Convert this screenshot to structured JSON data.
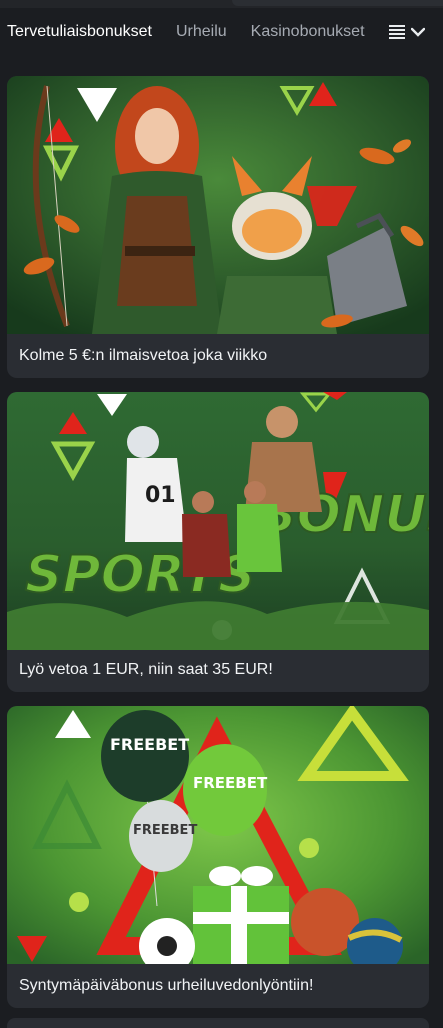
{
  "nav": {
    "tabs": [
      {
        "label": "Tervetuliaisbonukset",
        "active": true
      },
      {
        "label": "Urheilu",
        "active": false
      },
      {
        "label": "Kasinobonukset",
        "active": false
      }
    ],
    "menu_icon": "list-icon",
    "menu_chevron": "chevron-down-icon"
  },
  "promotions": [
    {
      "title": "Kolme 5 €:n ilmaisvetoa joka viikko",
      "image": "archer-and-fox-promo-image"
    },
    {
      "title": "Lyö vetoa 1 EUR, niin saat 35 EUR!",
      "image": "sports-bonus-promo-image",
      "image_text": "SPORTS BONUS"
    },
    {
      "title": "Syntymäpäiväbonus urheiluvedonlyöntiin!",
      "image": "freebet-balloons-promo-image",
      "image_text": "FREEBET"
    }
  ],
  "colors": {
    "background": "#1b1d21",
    "card": "#2a2d33",
    "accent_green": "#7fd13b",
    "accent_red": "#e0241b",
    "tab_active": "#ffffff",
    "tab_inactive": "#a6abb3"
  }
}
